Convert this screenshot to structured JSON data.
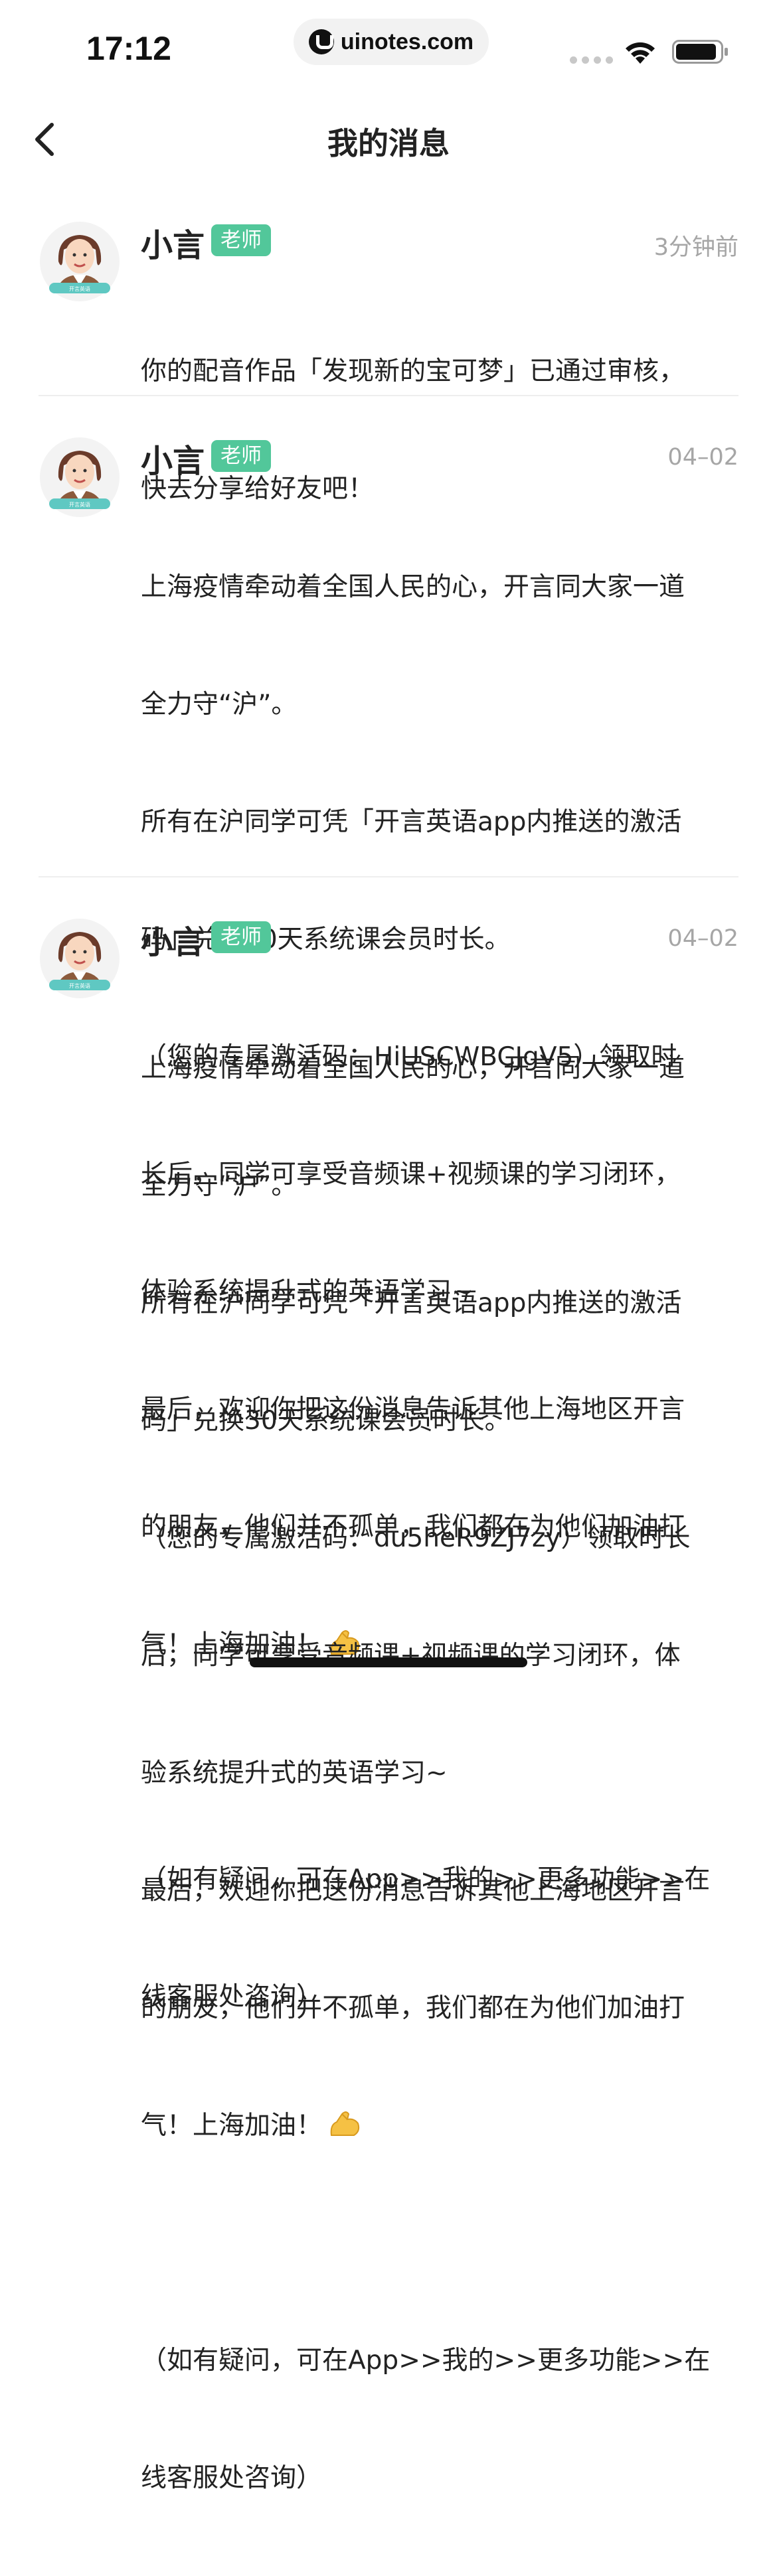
{
  "status_bar": {
    "time": "17:12",
    "url": "uinotes.com",
    "icons": [
      "signal-dots-icon",
      "wifi-icon",
      "battery-icon"
    ]
  },
  "nav": {
    "title": "我的消息",
    "back_icon": "chevron-left-icon"
  },
  "colors": {
    "badge": "#52c79a",
    "time_gray": "#a6a6a6",
    "divider": "#eeeeee"
  },
  "messages": [
    {
      "sender": "小言",
      "badge": "老师",
      "time": "3分钟前",
      "avatar_icon": "teacher-avatar-icon",
      "lines": [
        "你的配音作品「发现新的宝可梦」已通过审核，",
        "快去分享给好友吧！"
      ]
    },
    {
      "sender": "小言",
      "badge": "老师",
      "time": "04–02",
      "avatar_icon": "teacher-avatar-icon",
      "lines": [
        "上海疫情牵动着全国人民的心，开言同大家一道",
        "全力守“沪”。",
        "所有在沪同学可凭「开言英语app内推送的激活",
        "码」兑换30天系统课会员时长。",
        "（您的专属激活码：HiUSCWBCJgV5）领取时",
        "长后，同学可享受音频课+视频课的学习闭环，",
        "体验系统提升式的英语学习~",
        "最后，欢迎你把这份消息告诉其他上海地区开言",
        "的朋友，他们并不孤单，我们都在为他们加油打",
        "气！上海加油！",
        "",
        "（如有疑问，可在App>>我的>>更多功能>>在",
        "线客服处咨询）"
      ],
      "emoji_icon": "flexed-biceps-icon"
    },
    {
      "sender": "小言",
      "badge": "老师",
      "time": "04–02",
      "avatar_icon": "teacher-avatar-icon",
      "lines": [
        "上海疫情牵动着全国人民的心，开言同大家一道",
        "全力守“沪”。",
        "所有在沪同学可凭「开言英语app内推送的激活",
        "码」兑换30天系统课会员时长。",
        "（您的专属激活码：du5heR9ZJ7zy）领取时长",
        "后，同学可享受音频课+视频课的学习闭环，体",
        "验系统提升式的英语学习~",
        "最后，欢迎你把这份消息告诉其他上海地区开言",
        "的朋友，他们并不孤单，我们都在为他们加油打",
        "气！上海加油！",
        "",
        "（如有疑问，可在App>>我的>>更多功能>>在",
        "线客服处咨询）"
      ],
      "emoji_icon": "flexed-biceps-icon"
    }
  ]
}
